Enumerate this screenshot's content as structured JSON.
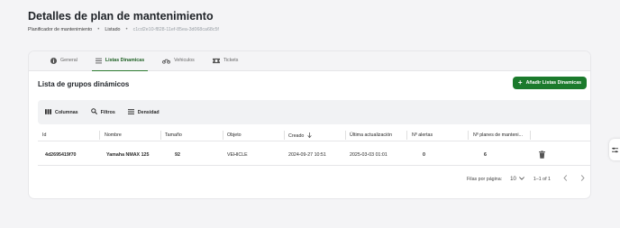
{
  "page": {
    "title": "Detalles de plan de mantenimiento"
  },
  "breadcrumb": {
    "items": [
      "Planificador de mantenimiento",
      "Listado",
      "c1cd2e10-f828-11ef-85ea-3d068ca68c5f"
    ],
    "separator": "•"
  },
  "tabs": [
    {
      "label": "General",
      "icon": "info-icon",
      "active": false
    },
    {
      "label": "Listas Dinamicas",
      "icon": "list-icon",
      "active": true
    },
    {
      "label": "Vehiculos",
      "icon": "motorcycle-icon",
      "active": false
    },
    {
      "label": "Tickets",
      "icon": "ticket-icon",
      "active": false
    }
  ],
  "section": {
    "title": "Lista de grupos dinámicos",
    "add_button": "Añadir Listas Dinamicas"
  },
  "toolbar": {
    "columns": "Columnas",
    "filters": "Filtros",
    "density": "Densidad"
  },
  "table": {
    "headers": [
      "Id",
      "Nombre",
      "Tamaño",
      "Objeto",
      "Creado",
      "Última actualización",
      "Nº alertas",
      "Nº planes de manteni..."
    ],
    "rows": [
      {
        "id": "4d2695419f70",
        "nombre": "Yamaha NMAX 125",
        "tamano": "92",
        "objeto": "VEHICLE",
        "creado": "2024-09-27 10:51",
        "actualizacion": "2025-03-03 01:01",
        "alertas": "0",
        "planes": "6"
      }
    ]
  },
  "pagination": {
    "rows_label": "Filas por página:",
    "rows_value": "10",
    "range": "1–1 of 1"
  },
  "colors": {
    "accent": "#1b7a2c",
    "accent_text": "#1b5e20"
  }
}
